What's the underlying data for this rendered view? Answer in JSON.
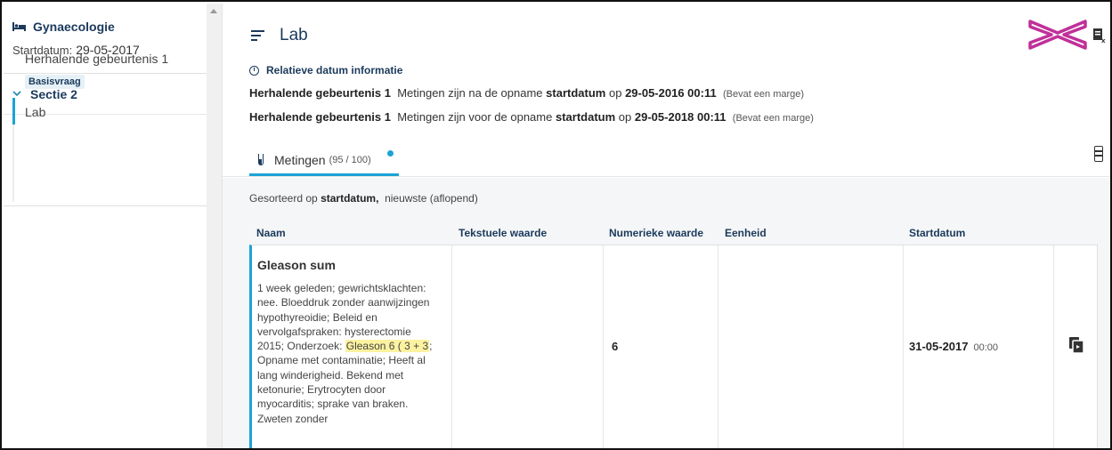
{
  "sidebar": {
    "ward": "Gynaecologie",
    "start_label": "Startdatum:",
    "start_value": "29-05-2017",
    "section": "Sectie 2",
    "items": [
      {
        "label": "Herhalende gebeurtenis 1",
        "badge": "Basisvraag"
      },
      {
        "label": "Lab"
      }
    ]
  },
  "header": {
    "title": "Lab"
  },
  "info": {
    "heading": "Relatieve datum informatie",
    "rows": [
      {
        "event": "Herhalende gebeurtenis 1",
        "text1": "Metingen zijn na de opname",
        "field": "startdatum",
        "prep": "op",
        "datetime": "29-05-2016 00:11",
        "note": "(Bevat een marge)"
      },
      {
        "event": "Herhalende gebeurtenis 1",
        "text1": "Metingen zijn voor de opname",
        "field": "startdatum",
        "prep": "op",
        "datetime": "29-05-2018 00:11",
        "note": "(Bevat een marge)"
      }
    ]
  },
  "tab": {
    "label": "Metingen",
    "count": "(95 / 100)"
  },
  "sort": {
    "prefix": "Gesorteerd op",
    "field": "startdatum,",
    "order": "nieuwste (aflopend)"
  },
  "table": {
    "columns": [
      "Naam",
      "Tekstuele waarde",
      "Numerieke waarde",
      "Eenheid",
      "Startdatum"
    ],
    "row": {
      "name": "Gleason sum",
      "desc_before": "1 week geleden; gewrichtsklachten: nee. Bloeddruk zonder aanwijzingen hypothyreoidie; Beleid en vervolgafspraken: hysterectomie 2015; Onderzoek: ",
      "desc_highlight": "Gleason 6 ( 3 + 3",
      "desc_after": "; Opname met contaminatie; Heeft al lang winderigheid. Bekend met ketonurie; Erytrocyten door myocarditis; sprake van braken. Zweten zonder",
      "numeric": "6",
      "date": "31-05-2017",
      "time": "00:00"
    }
  },
  "colors": {
    "accent": "#1ba3d6",
    "navy": "#1b3a5c",
    "logo": "#c0309a",
    "highlight": "#fdf2a0"
  }
}
